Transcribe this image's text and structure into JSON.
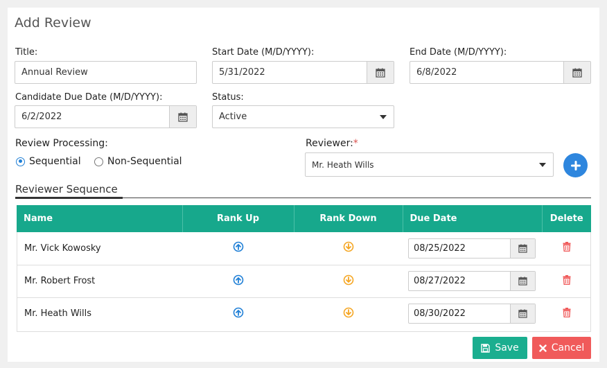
{
  "header": {
    "title": "Add Review"
  },
  "form": {
    "title_label": "Title:",
    "title_value": "Annual Review",
    "start_label": "Start Date (M/D/YYYY):",
    "start_value": "5/31/2022",
    "end_label": "End Date (M/D/YYYY):",
    "end_value": "6/8/2022",
    "cand_label": "Candidate Due Date (M/D/YYYY):",
    "cand_value": "6/2/2022",
    "status_label": "Status:",
    "status_value": "Active",
    "processing_label": "Review Processing:",
    "opt_sequential": "Sequential",
    "opt_nonsequential": "Non-Sequential",
    "reviewer_label": "Reviewer:",
    "reviewer_required": "*",
    "reviewer_value": "Mr. Heath Wills"
  },
  "sequence": {
    "title": "Reviewer Sequence",
    "columns": [
      "Name",
      "Rank Up",
      "Rank Down",
      "Due Date",
      "Delete"
    ],
    "rows": [
      {
        "name": "Mr. Vick Kowosky",
        "due": "08/25/2022"
      },
      {
        "name": "Mr. Robert Frost",
        "due": "08/27/2022"
      },
      {
        "name": "Mr. Heath Wills",
        "due": "08/30/2022"
      }
    ]
  },
  "actions": {
    "save": "Save",
    "cancel": "Cancel"
  },
  "colors": {
    "teal": "#17a88c",
    "blue": "#2e86de",
    "orange": "#f5a623",
    "red": "#f05a5a"
  },
  "icons": [
    "calendar-icon",
    "chevron-down-icon",
    "plus-icon",
    "arrow-up-circle-icon",
    "arrow-down-circle-icon",
    "trash-icon",
    "save-icon",
    "close-icon"
  ]
}
